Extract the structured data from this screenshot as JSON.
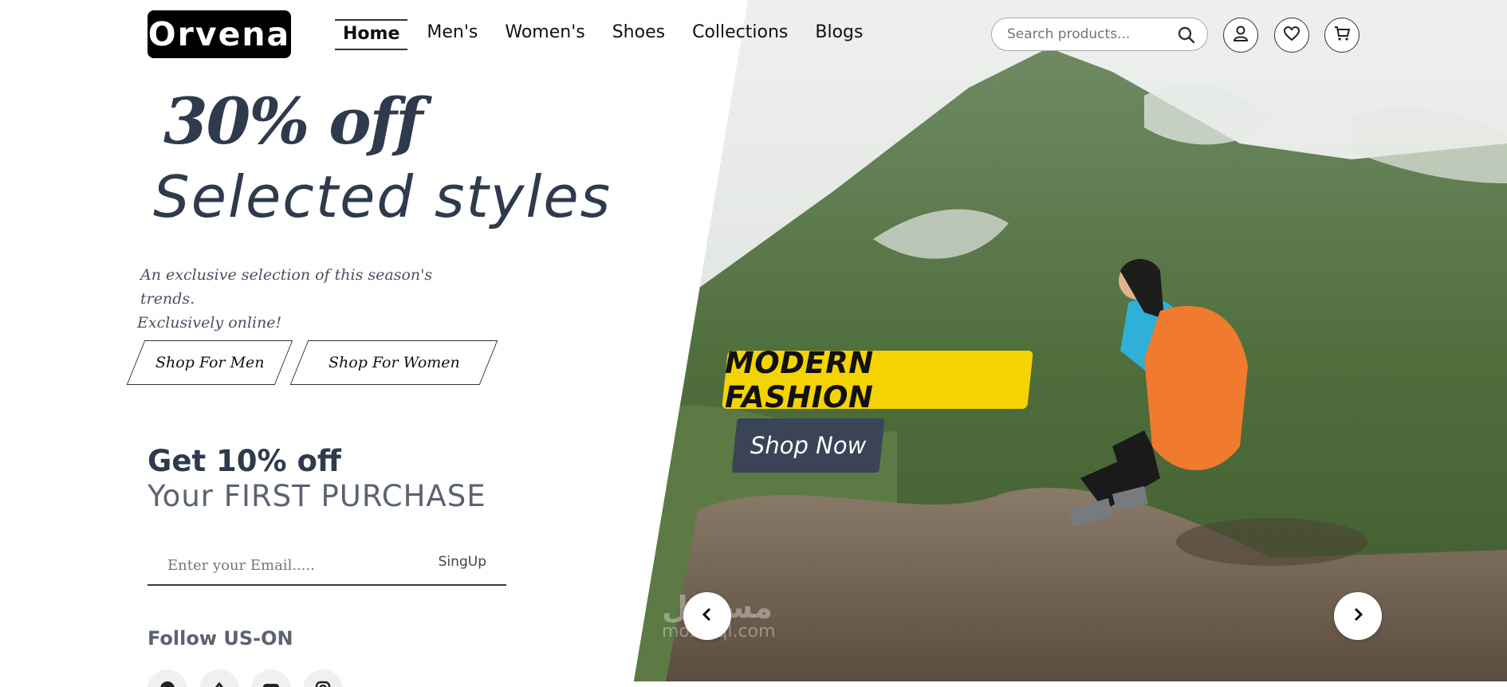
{
  "brand": {
    "logo_text": "Orvena"
  },
  "nav": {
    "items": [
      {
        "label": "Home",
        "active": true
      },
      {
        "label": "Men's"
      },
      {
        "label": "Women's"
      },
      {
        "label": "Shoes"
      },
      {
        "label": "Collections"
      },
      {
        "label": "Blogs"
      }
    ]
  },
  "search": {
    "placeholder": "Search products..."
  },
  "header_icons": [
    "search-icon",
    "user-icon",
    "heart-icon",
    "cart-icon"
  ],
  "promo": {
    "headline": "30% off",
    "subheadline": "Selected styles",
    "description_line1": "An exclusive selection of this season's trends.",
    "description_line2": "Exclusively online!",
    "shop_men": "Shop For Men",
    "shop_women": "Shop For Women"
  },
  "newsletter": {
    "title": "Get 10% off",
    "subtitle": "Your FIRST PURCHASE",
    "email_placeholder": "Enter your Email.....",
    "signup_label": "SingUp"
  },
  "follow": {
    "title": "Follow US-ON",
    "icons": [
      "facebook-icon",
      "twitter-icon",
      "youtube-icon",
      "instagram-icon"
    ]
  },
  "hero": {
    "badge": "MODERN FASHION",
    "cta": "Shop Now",
    "prev_icon": "chevron-left-icon",
    "next_icon": "chevron-right-icon",
    "watermark": "مستقل",
    "watermark_sub": "mostaql.com"
  },
  "colors": {
    "text_dark": "#2f3a4d",
    "badge_yellow": "#f4d400",
    "cta_dark": "#3a4456",
    "logo_bg": "#000000"
  }
}
